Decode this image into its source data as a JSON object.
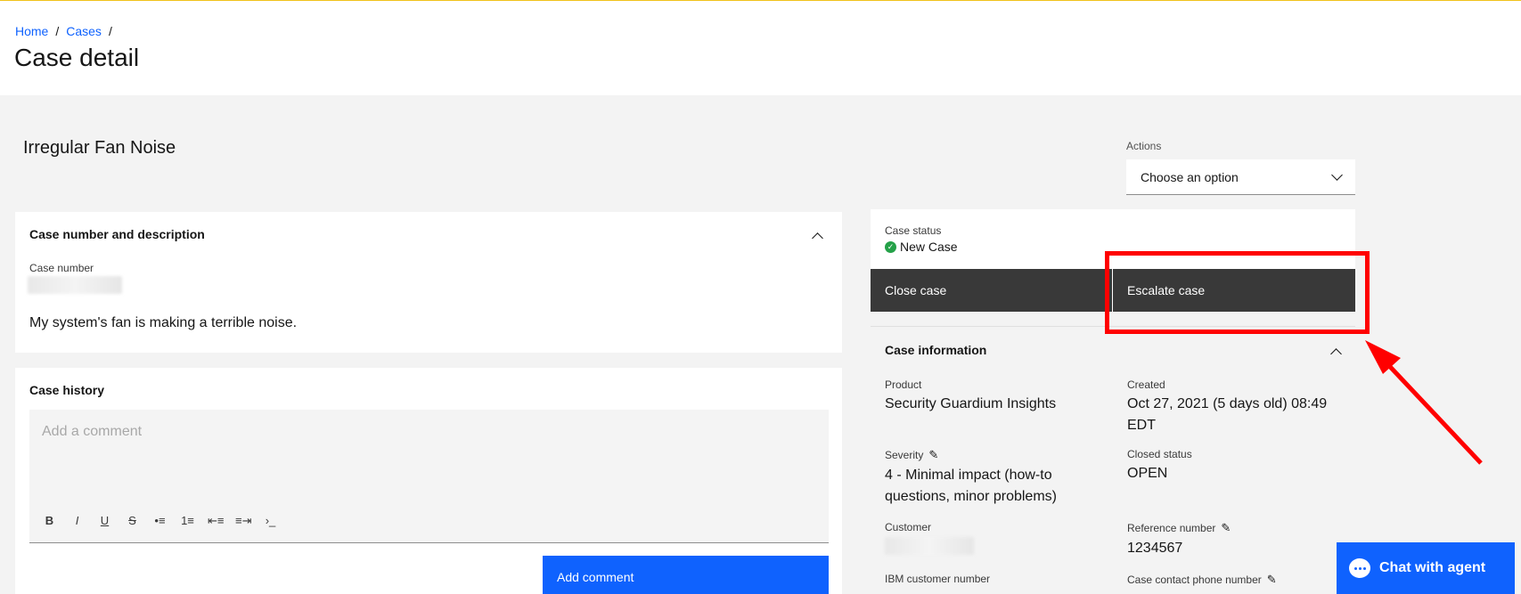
{
  "breadcrumb": {
    "home": "Home",
    "cases": "Cases",
    "separator": "/"
  },
  "page_title": "Case detail",
  "case_title": "Irregular Fan Noise",
  "actions": {
    "label": "Actions",
    "placeholder": "Choose an option"
  },
  "description_card": {
    "heading": "Case number and description",
    "case_number_label": "Case number",
    "description": "My system's fan is making a terrible noise."
  },
  "history_card": {
    "heading": "Case history",
    "comment_placeholder": "Add a comment",
    "toolbar": [
      "B",
      "I",
      "U",
      "S",
      "•≡",
      "1≡",
      "⇤≡",
      "≡⇥",
      "›_"
    ],
    "add_comment_label": "Add comment"
  },
  "status_card": {
    "status_label": "Case status",
    "status_value": "New Case",
    "close_label": "Close case",
    "escalate_label": "Escalate case"
  },
  "info_card": {
    "heading": "Case information",
    "product_label": "Product",
    "product_value": "Security Guardium Insights",
    "created_label": "Created",
    "created_value": "Oct 27, 2021 (5 days old) 08:49 EDT",
    "severity_label": "Severity",
    "severity_value": "4 - Minimal impact (how-to questions, minor problems)",
    "closed_status_label": "Closed status",
    "closed_status_value": "OPEN",
    "customer_label": "Customer",
    "reference_label": "Reference number",
    "reference_value": "1234567",
    "ibm_customer_label": "IBM customer number",
    "phone_label": "Case contact phone number"
  },
  "chat": {
    "label": "Chat with agent"
  },
  "colors": {
    "primary": "#0f62fe",
    "dark_button": "#393939",
    "highlight": "#ff0000",
    "success": "#24a148"
  }
}
